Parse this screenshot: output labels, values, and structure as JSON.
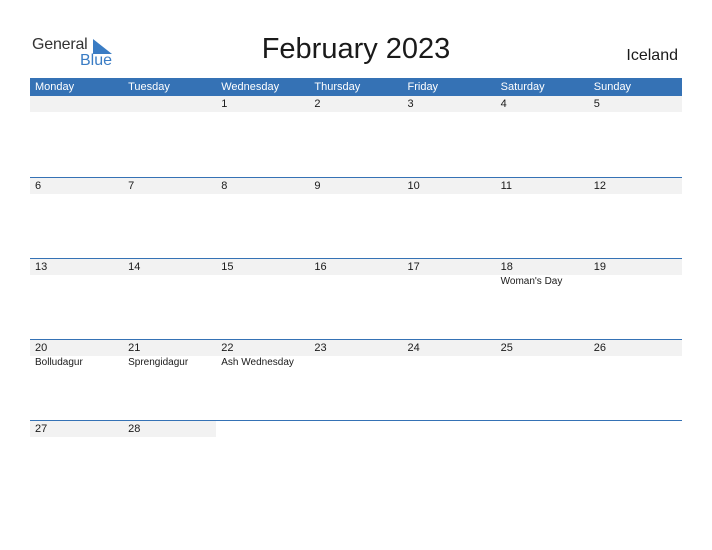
{
  "logo": {
    "line1": "General",
    "line2": "Blue"
  },
  "title": "February 2023",
  "country": "Iceland",
  "colors": {
    "header_bg": "#3572b5",
    "date_row_bg": "#f2f2f2",
    "logo_blue": "#3a7cc4"
  },
  "weekdays": [
    "Monday",
    "Tuesday",
    "Wednesday",
    "Thursday",
    "Friday",
    "Saturday",
    "Sunday"
  ],
  "weeks": [
    {
      "days": [
        {
          "date": ""
        },
        {
          "date": ""
        },
        {
          "date": "1"
        },
        {
          "date": "2"
        },
        {
          "date": "3"
        },
        {
          "date": "4"
        },
        {
          "date": "5"
        }
      ]
    },
    {
      "days": [
        {
          "date": "6"
        },
        {
          "date": "7"
        },
        {
          "date": "8"
        },
        {
          "date": "9"
        },
        {
          "date": "10"
        },
        {
          "date": "11"
        },
        {
          "date": "12"
        }
      ]
    },
    {
      "days": [
        {
          "date": "13"
        },
        {
          "date": "14"
        },
        {
          "date": "15"
        },
        {
          "date": "16"
        },
        {
          "date": "17"
        },
        {
          "date": "18",
          "holiday": "Woman's Day"
        },
        {
          "date": "19"
        }
      ]
    },
    {
      "days": [
        {
          "date": "20",
          "holiday": "Bolludagur"
        },
        {
          "date": "21",
          "holiday": "Sprengidagur"
        },
        {
          "date": "22",
          "holiday": "Ash Wednesday"
        },
        {
          "date": "23"
        },
        {
          "date": "24"
        },
        {
          "date": "25"
        },
        {
          "date": "26"
        }
      ]
    },
    {
      "days": [
        {
          "date": "27"
        },
        {
          "date": "28"
        },
        {
          "date": ""
        },
        {
          "date": ""
        },
        {
          "date": ""
        },
        {
          "date": ""
        },
        {
          "date": ""
        }
      ]
    }
  ]
}
